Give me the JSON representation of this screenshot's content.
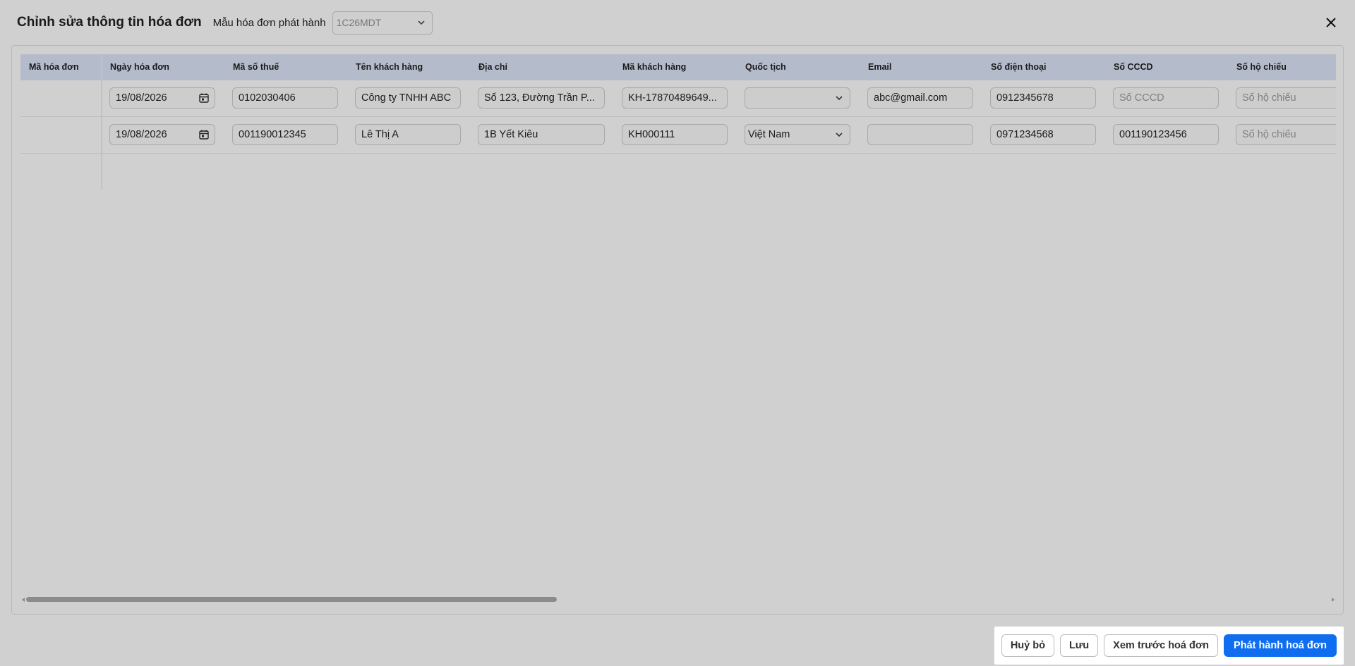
{
  "header": {
    "title": "Chỉnh sửa thông tin hóa đơn",
    "template_label": "Mẫu hóa đơn phát hành",
    "template_value": "1C26MDT"
  },
  "table": {
    "columns": [
      "Mã hóa đơn",
      "Ngày hóa đơn",
      "Mã số thuế",
      "Tên khách hàng",
      "Địa chỉ",
      "Mã khách hàng",
      "Quốc tịch",
      "Email",
      "Số điện thoại",
      "Số CCCD",
      "Số hộ chiếu"
    ],
    "rows": [
      {
        "invoice_code": "",
        "date": "19/08/2026",
        "tax_code": "0102030406",
        "customer_name": "Công ty TNHH ABC",
        "address": "Số 123, Đường Trần P...",
        "customer_code": "KH-17870489649...",
        "nationality": "",
        "email": "abc@gmail.com",
        "phone": "0912345678",
        "cccd": "",
        "passport": ""
      },
      {
        "invoice_code": "",
        "date": "19/08/2026",
        "tax_code": "001190012345",
        "customer_name": "Lê Thị A",
        "address": "1B Yết Kiêu",
        "customer_code": "KH000111",
        "nationality": "Việt Nam",
        "email": "",
        "phone": "0971234568",
        "cccd": "001190123456",
        "passport": ""
      }
    ],
    "placeholders": {
      "cccd": "Số CCCD",
      "passport": "Số hộ chiếu"
    }
  },
  "footer": {
    "cancel_label": "Huỷ bỏ",
    "save_label": "Lưu",
    "preview_label": "Xem trước hoá đơn",
    "publish_label": "Phát hành hoá đơn"
  },
  "colors": {
    "primary": "#0f6ef0",
    "header_bg": "#b4bccb",
    "overlay_bg": "#d0d0d0"
  },
  "icons": {
    "close": "close-icon",
    "calendar": "calendar-icon",
    "dropdown": "chevron-down-icon"
  }
}
